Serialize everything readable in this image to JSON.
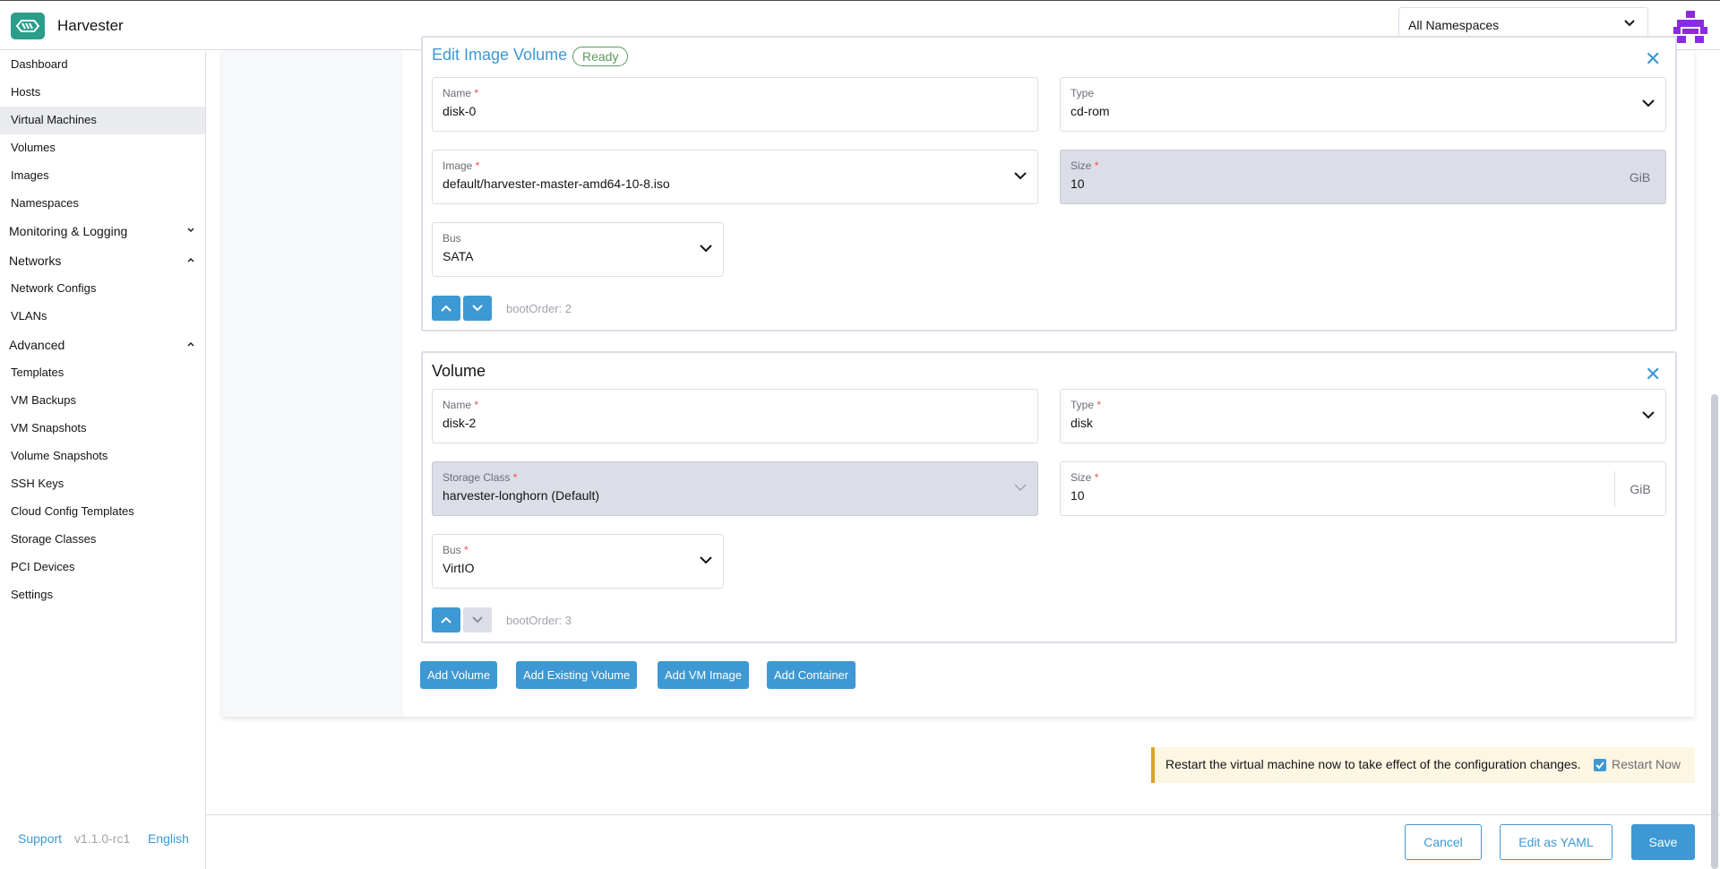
{
  "header": {
    "app_title": "Harvester",
    "namespace_select": "All Namespaces"
  },
  "sidebar": {
    "items": [
      {
        "label": "Dashboard"
      },
      {
        "label": "Hosts"
      },
      {
        "label": "Virtual Machines",
        "active": true
      },
      {
        "label": "Volumes"
      },
      {
        "label": "Images"
      },
      {
        "label": "Namespaces"
      }
    ],
    "groups": {
      "monitoring": "Monitoring & Logging",
      "networks": "Networks",
      "advanced": "Advanced"
    },
    "network_items": [
      {
        "label": "Network Configs"
      },
      {
        "label": "VLANs"
      }
    ],
    "advanced_items": [
      {
        "label": "Templates"
      },
      {
        "label": "VM Backups"
      },
      {
        "label": "VM Snapshots"
      },
      {
        "label": "Volume Snapshots"
      },
      {
        "label": "SSH Keys"
      },
      {
        "label": "Cloud Config Templates"
      },
      {
        "label": "Storage Classes"
      },
      {
        "label": "PCI Devices"
      },
      {
        "label": "Settings"
      }
    ],
    "footer": {
      "support": "Support",
      "version": "v1.1.0-rc1",
      "language": "English"
    }
  },
  "volume1": {
    "title": "Edit Image Volume",
    "status": "Ready",
    "name_label": "Name",
    "name_value": "disk-0",
    "type_label": "Type",
    "type_value": "cd-rom",
    "image_label": "Image",
    "image_value": "default/harvester-master-amd64-10-8.iso",
    "size_label": "Size",
    "size_value": "10",
    "size_unit": "GiB",
    "bus_label": "Bus",
    "bus_value": "SATA",
    "boot_order": "bootOrder: 2"
  },
  "volume2": {
    "title": "Volume",
    "name_label": "Name",
    "name_value": "disk-2",
    "type_label": "Type",
    "type_value": "disk",
    "storage_label": "Storage Class",
    "storage_value": "harvester-longhorn (Default)",
    "size_label": "Size",
    "size_value": "10",
    "size_unit": "GiB",
    "bus_label": "Bus",
    "bus_value": "VirtIO",
    "boot_order": "bootOrder: 3"
  },
  "actions": {
    "add_volume": "Add Volume",
    "add_existing_volume": "Add Existing Volume",
    "add_vm_image": "Add VM Image",
    "add_container": "Add Container"
  },
  "notice": {
    "message": "Restart the virtual machine now to take effect of the configuration changes.",
    "checkbox_label": "Restart Now",
    "checked": true
  },
  "footer": {
    "cancel": "Cancel",
    "edit_yaml": "Edit as YAML",
    "save": "Save"
  },
  "colors": {
    "accent": "#3d98d3",
    "brand": "#2b9d8b",
    "success": "#5d995d",
    "required": "#f64747",
    "warning": "#daa520"
  }
}
